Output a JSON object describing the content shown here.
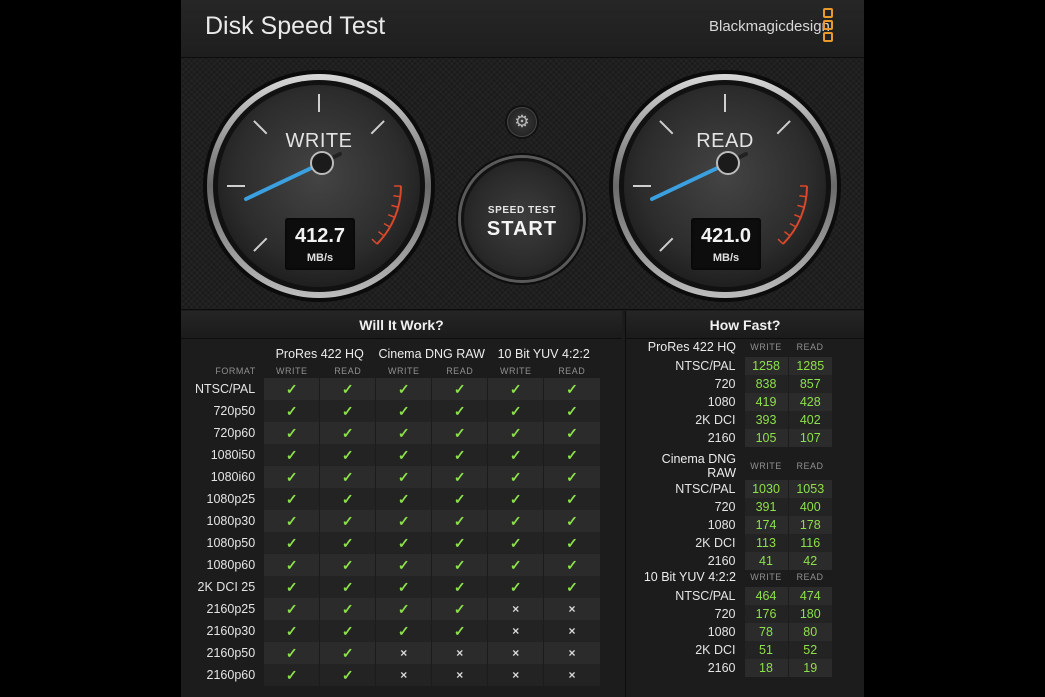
{
  "window": {
    "close_label": "×"
  },
  "header": {
    "title": "Disk Speed Test",
    "brand": "Blackmagicdesign"
  },
  "gauges": {
    "write": {
      "label": "WRITE",
      "value": "412.7",
      "unit": "MB/s"
    },
    "read": {
      "label": "READ",
      "value": "421.0",
      "unit": "MB/s"
    }
  },
  "controls": {
    "settings_icon": "gear-icon",
    "start_small": "SPEED TEST",
    "start_big": "START"
  },
  "will_it_work": {
    "title": "Will It Work?",
    "format_label": "FORMAT",
    "groups": [
      "ProRes 422 HQ",
      "Cinema DNG RAW",
      "10 Bit YUV 4:2:2"
    ],
    "sub_cols": [
      "WRITE",
      "READ"
    ],
    "rows": [
      {
        "format": "NTSC/PAL",
        "marks": [
          "✓",
          "✓",
          "✓",
          "✓",
          "✓",
          "✓"
        ]
      },
      {
        "format": "720p50",
        "marks": [
          "✓",
          "✓",
          "✓",
          "✓",
          "✓",
          "✓"
        ]
      },
      {
        "format": "720p60",
        "marks": [
          "✓",
          "✓",
          "✓",
          "✓",
          "✓",
          "✓"
        ]
      },
      {
        "format": "1080i50",
        "marks": [
          "✓",
          "✓",
          "✓",
          "✓",
          "✓",
          "✓"
        ]
      },
      {
        "format": "1080i60",
        "marks": [
          "✓",
          "✓",
          "✓",
          "✓",
          "✓",
          "✓"
        ]
      },
      {
        "format": "1080p25",
        "marks": [
          "✓",
          "✓",
          "✓",
          "✓",
          "✓",
          "✓"
        ]
      },
      {
        "format": "1080p30",
        "marks": [
          "✓",
          "✓",
          "✓",
          "✓",
          "✓",
          "✓"
        ]
      },
      {
        "format": "1080p50",
        "marks": [
          "✓",
          "✓",
          "✓",
          "✓",
          "✓",
          "✓"
        ]
      },
      {
        "format": "1080p60",
        "marks": [
          "✓",
          "✓",
          "✓",
          "✓",
          "✓",
          "✓"
        ]
      },
      {
        "format": "2K DCI 25",
        "marks": [
          "✓",
          "✓",
          "✓",
          "✓",
          "✓",
          "✓"
        ]
      },
      {
        "format": "2160p25",
        "marks": [
          "✓",
          "✓",
          "✓",
          "✓",
          "×",
          "×"
        ]
      },
      {
        "format": "2160p30",
        "marks": [
          "✓",
          "✓",
          "✓",
          "✓",
          "×",
          "×"
        ]
      },
      {
        "format": "2160p50",
        "marks": [
          "✓",
          "✓",
          "×",
          "×",
          "×",
          "×"
        ]
      },
      {
        "format": "2160p60",
        "marks": [
          "✓",
          "✓",
          "×",
          "×",
          "×",
          "×"
        ]
      }
    ]
  },
  "how_fast": {
    "title": "How Fast?",
    "col_write": "WRITE",
    "col_read": "READ",
    "sections": [
      {
        "name": "ProRes 422 HQ",
        "rows": [
          {
            "label": "NTSC/PAL",
            "write": "1258",
            "read": "1285"
          },
          {
            "label": "720",
            "write": "838",
            "read": "857"
          },
          {
            "label": "1080",
            "write": "419",
            "read": "428"
          },
          {
            "label": "2K DCI",
            "write": "393",
            "read": "402"
          },
          {
            "label": "2160",
            "write": "105",
            "read": "107"
          }
        ]
      },
      {
        "name": "Cinema DNG RAW",
        "rows": [
          {
            "label": "NTSC/PAL",
            "write": "1030",
            "read": "1053"
          },
          {
            "label": "720",
            "write": "391",
            "read": "400"
          },
          {
            "label": "1080",
            "write": "174",
            "read": "178"
          },
          {
            "label": "2K DCI",
            "write": "113",
            "read": "116"
          },
          {
            "label": "2160",
            "write": "41",
            "read": "42"
          }
        ]
      },
      {
        "name": "10 Bit YUV 4:2:2",
        "rows": [
          {
            "label": "NTSC/PAL",
            "write": "464",
            "read": "474"
          },
          {
            "label": "720",
            "write": "176",
            "read": "180"
          },
          {
            "label": "1080",
            "write": "78",
            "read": "80"
          },
          {
            "label": "2K DCI",
            "write": "51",
            "read": "52"
          },
          {
            "label": "2160",
            "write": "18",
            "read": "19"
          }
        ]
      }
    ]
  },
  "colors": {
    "accent_needle": "#3aa0e0",
    "ok_green": "#8de04a",
    "brand_orange": "#e99a2a",
    "redline": "#d9482a"
  }
}
